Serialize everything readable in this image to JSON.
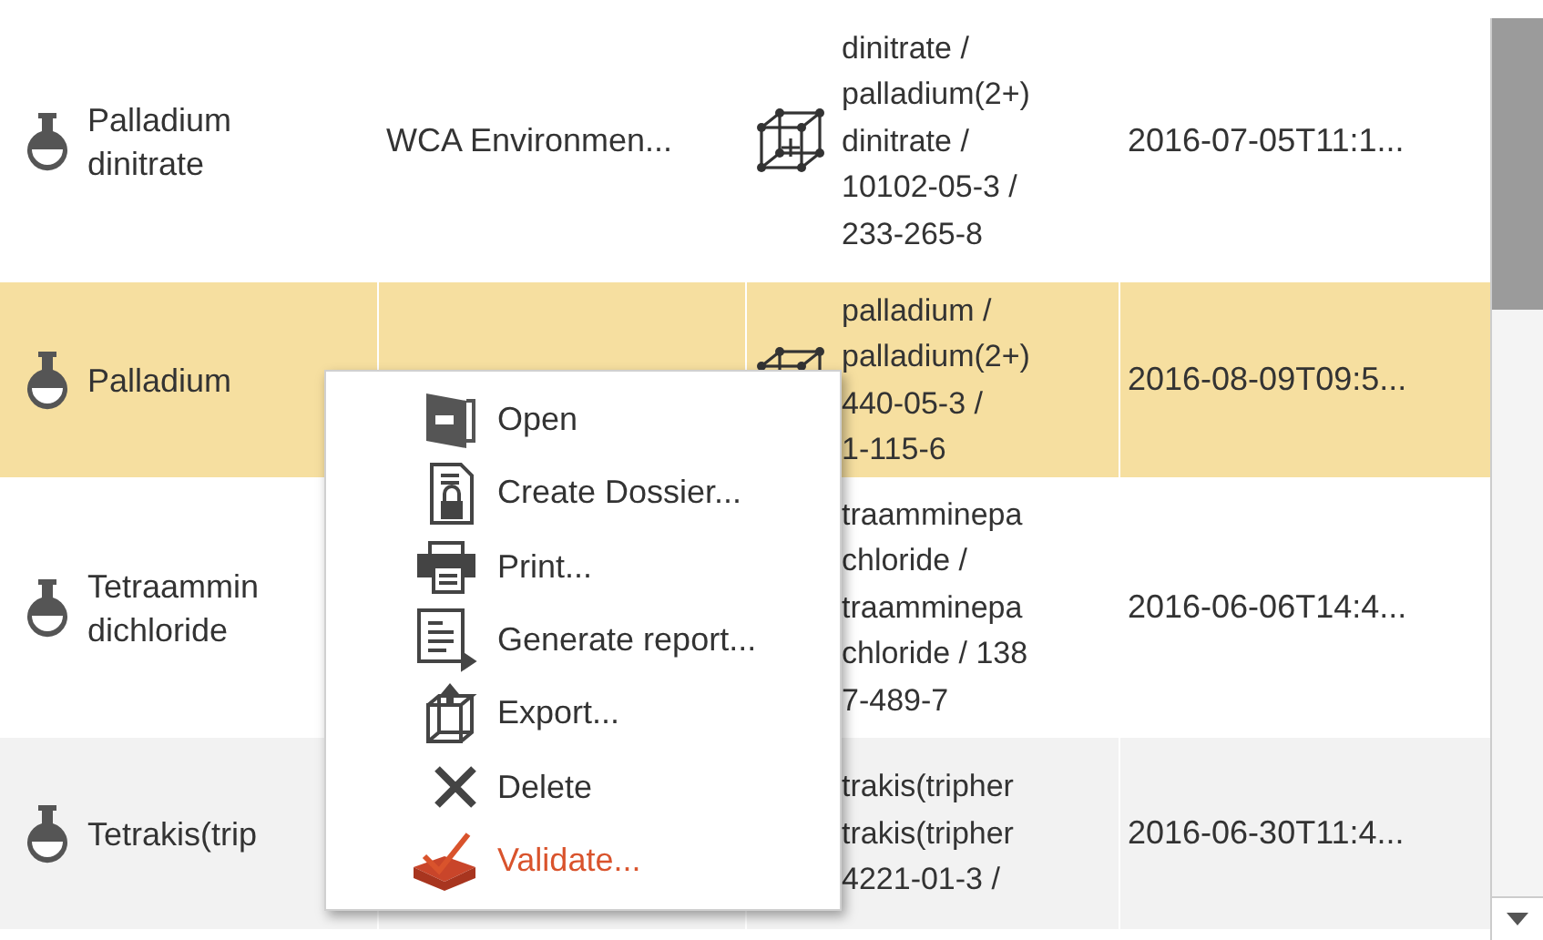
{
  "table": {
    "rows": [
      {
        "name": [
          "Palladium",
          "dinitrate"
        ],
        "owner": "WCA Environmen...",
        "ids": [
          "dinitrate /",
          "palladium(2+)",
          "dinitrate /",
          "10102-05-3 /",
          "233-265-8"
        ],
        "date": "2016-07-05T11:1...",
        "selected": false
      },
      {
        "name": [
          "Palladium"
        ],
        "ids": [
          "palladium /",
          "palladium(2+)",
          "440-05-3 /",
          "1-115-6"
        ],
        "date": "2016-08-09T09:5...",
        "selected": true
      },
      {
        "name": [
          "Tetraammin",
          "dichloride"
        ],
        "ids": [
          "traamminepa",
          "chloride /",
          "traamminepa",
          "chloride / 138",
          "7-489-7"
        ],
        "date": "2016-06-06T14:4...",
        "selected": false
      },
      {
        "name": [
          "Tetrakis(trip"
        ],
        "ids": [
          "trakis(tripher",
          "trakis(tripher",
          "4221-01-3 /"
        ],
        "date": "2016-06-30T11:4...",
        "selected": false
      }
    ]
  },
  "context_menu": {
    "items": [
      {
        "label": "Open",
        "color": "#333333"
      },
      {
        "label": "Create Dossier...",
        "color": "#333333"
      },
      {
        "label": "Print...",
        "color": "#333333"
      },
      {
        "label": "Generate report...",
        "color": "#333333"
      },
      {
        "label": "Export...",
        "color": "#333333"
      },
      {
        "label": "Delete",
        "color": "#333333"
      },
      {
        "label": "Validate...",
        "color": "#d9532c"
      }
    ]
  }
}
